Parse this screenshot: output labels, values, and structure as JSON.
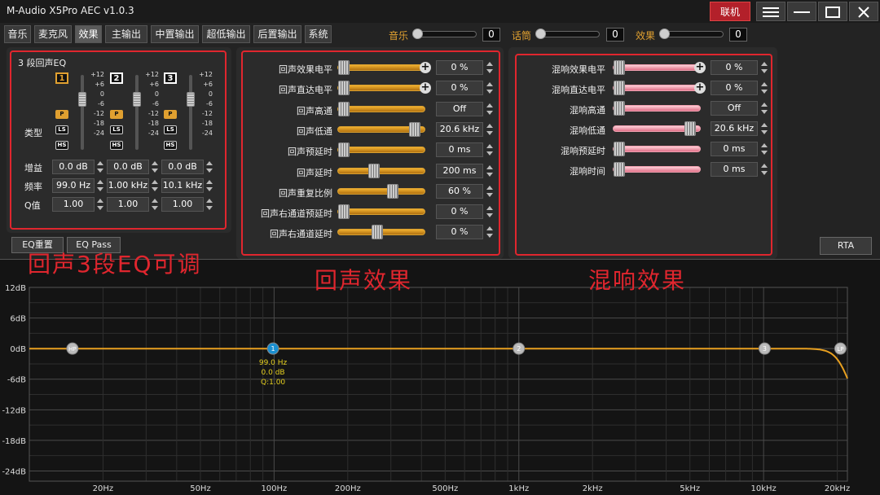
{
  "window": {
    "title": "M-Audio X5Pro AEC  v1.0.3",
    "online_label": "联机"
  },
  "tabs": [
    "音乐",
    "麦克风",
    "效果",
    "主输出",
    "中置输出",
    "超低输出",
    "后置输出",
    "系统"
  ],
  "active_tab": "效果",
  "top_sliders": [
    {
      "label": "音乐",
      "value": "0",
      "level": 0
    },
    {
      "label": "话筒",
      "value": "0",
      "level": 0
    },
    {
      "label": "效果",
      "value": "0",
      "level": 0
    }
  ],
  "eq": {
    "title": "3 段回声EQ",
    "bands": [
      "1",
      "2",
      "3"
    ],
    "scale": [
      "+12",
      "+6",
      "0",
      "-6",
      "-12",
      "-18",
      "-24"
    ],
    "type_label": "类型",
    "type_buttons": [
      "P",
      "LS",
      "HS"
    ],
    "rows": [
      {
        "label": "增益",
        "values": [
          "0.0 dB",
          "0.0 dB",
          "0.0 dB"
        ]
      },
      {
        "label": "频率",
        "values": [
          "99.0 Hz",
          "1.00 kHz",
          "10.1 kHz"
        ]
      },
      {
        "label": "Q值",
        "values": [
          "1.00",
          "1.00",
          "1.00"
        ]
      }
    ],
    "reset_label": "EQ重置",
    "pass_label": "EQ Pass"
  },
  "echo": {
    "rows": [
      {
        "label": "回声效果电平",
        "value": "0 %",
        "plus": true,
        "level": 0
      },
      {
        "label": "回声直达电平",
        "value": "0 %",
        "plus": true,
        "level": 0
      },
      {
        "label": "回声高通",
        "value": "Off",
        "plus": false,
        "level": 0
      },
      {
        "label": "回声低通",
        "value": "20.6 kHz",
        "plus": false,
        "level": 0.95
      },
      {
        "label": "回声预延时",
        "value": "0 ms",
        "plus": false,
        "level": 0
      },
      {
        "label": "回声延时",
        "value": "200 ms",
        "plus": false,
        "level": 0.4
      },
      {
        "label": "回声重复比例",
        "value": "60 %",
        "plus": false,
        "level": 0.65
      },
      {
        "label": "回声右通道预延时",
        "value": "0 %",
        "plus": false,
        "level": 0
      },
      {
        "label": "回声右通道延时",
        "value": "0 %",
        "plus": false,
        "level": 0.45
      }
    ]
  },
  "reverb": {
    "rows": [
      {
        "label": "混响效果电平",
        "value": "0 %",
        "plus": true,
        "level": 0
      },
      {
        "label": "混响直达电平",
        "value": "0 %",
        "plus": true,
        "level": 0
      },
      {
        "label": "混响高通",
        "value": "Off",
        "plus": false,
        "level": 0
      },
      {
        "label": "混响低通",
        "value": "20.6 kHz",
        "plus": false,
        "level": 0.95
      },
      {
        "label": "混响预延时",
        "value": "0 ms",
        "plus": false,
        "level": 0
      },
      {
        "label": "混响时间",
        "value": "0 ms",
        "plus": false,
        "level": 0
      }
    ]
  },
  "rta_label": "RTA",
  "annotations": [
    "回声3段EQ可调",
    "回声效果",
    "混响效果"
  ],
  "chart_data": {
    "type": "line",
    "ylabels": [
      "12dB",
      "6dB",
      "0dB",
      "-6dB",
      "-12dB",
      "-18dB",
      "-24dB"
    ],
    "ylim": [
      -26,
      12
    ],
    "xlabels": [
      "20Hz",
      "50Hz",
      "100Hz",
      "200Hz",
      "500Hz",
      "1kHz",
      "2kHz",
      "5kHz",
      "10kHz",
      "20kHz"
    ],
    "xticks": [
      20,
      50,
      100,
      200,
      500,
      1000,
      2000,
      5000,
      10000,
      20000
    ],
    "xlim": [
      10,
      22000
    ],
    "nodes": [
      {
        "label": "HP",
        "freq": 15
      },
      {
        "label": "1",
        "freq": 99,
        "selected": true
      },
      {
        "label": "2",
        "freq": 1000
      },
      {
        "label": "3",
        "freq": 10100
      },
      {
        "label": "LP",
        "freq": 20600
      }
    ],
    "selected_info": [
      "99.0 Hz",
      "0.0 dB",
      "Q:1.00"
    ],
    "curve": {
      "gain_db": 0,
      "lowpass_hz": 20600
    },
    "colors": {
      "curve": "#e8a020",
      "selected_node": "#1a8fd0",
      "node": "#bbbbbb"
    }
  }
}
